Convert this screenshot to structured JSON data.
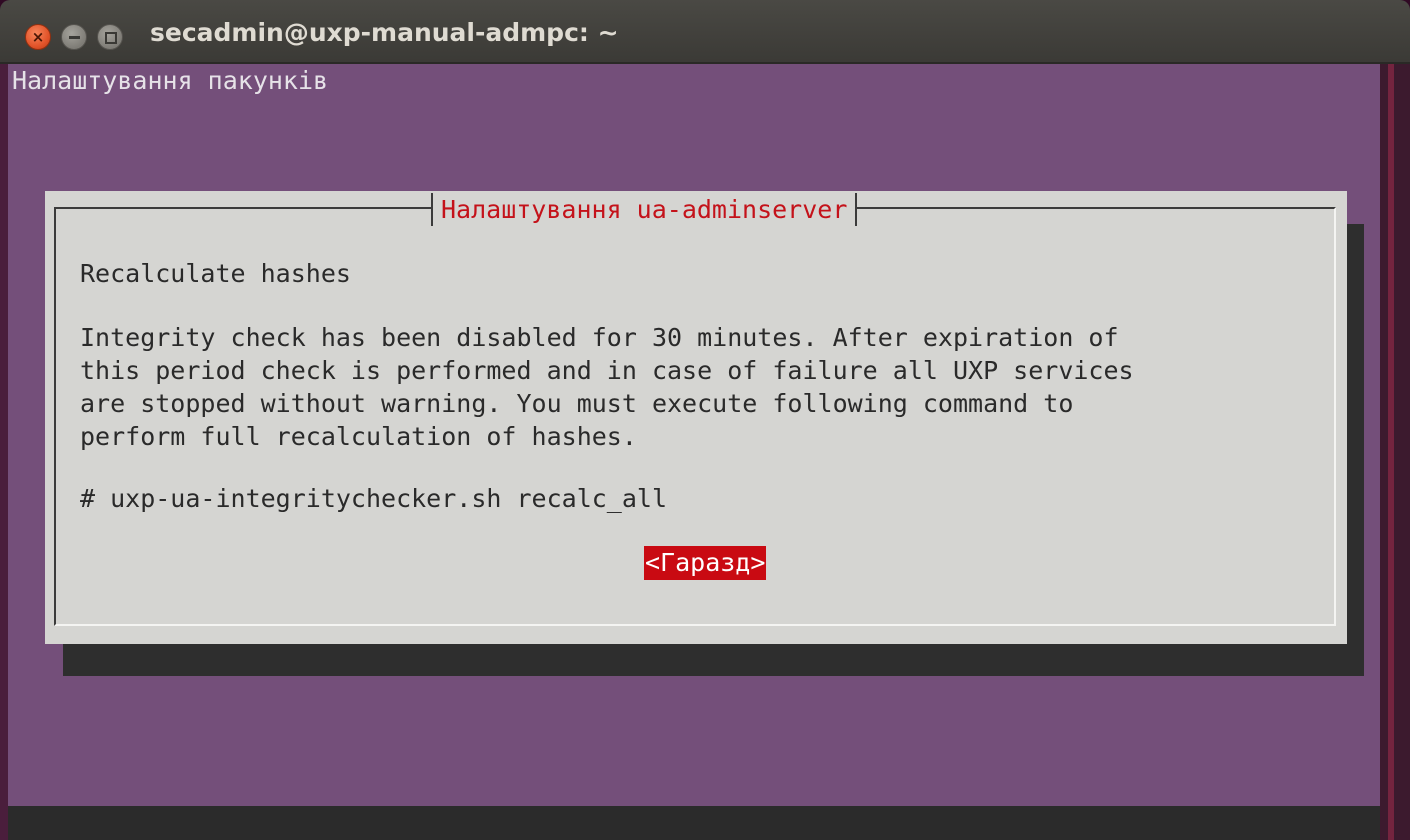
{
  "window": {
    "title": "secadmin@uxp-manual-admpc: ~",
    "close_glyph": "×"
  },
  "terminal": {
    "header": "Налаштування пакунків"
  },
  "dialog": {
    "title": "Налаштування ua-adminserver",
    "heading": "Recalculate hashes",
    "message_lines": [
      "Integrity check has been disabled for 30 minutes. After expiration of",
      "this period check is performed and in case of failure all UXP services",
      "are stopped without warning. You must execute following command to",
      "perform full recalculation of hashes."
    ],
    "command": "# uxp-ua-integritychecker.sh recalc_all",
    "ok_label": "<Гаразд>"
  },
  "colors": {
    "terminal_bg": "#744f7a",
    "dialog_bg": "#d5d5d2",
    "dialog_title": "#c4121a",
    "button_bg": "#c90a12"
  }
}
